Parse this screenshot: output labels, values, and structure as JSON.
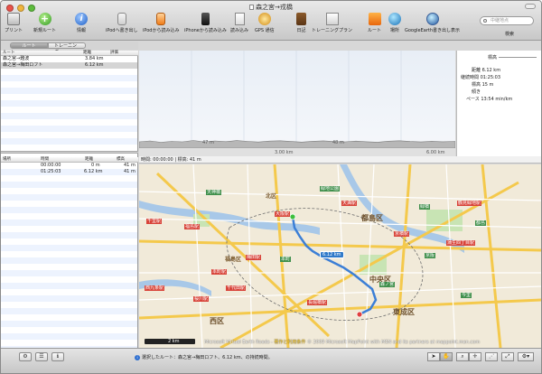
{
  "window": {
    "title": "森之宮→戎橋"
  },
  "toolbar": {
    "items": [
      {
        "label": "プリント",
        "icon": "printer-icon"
      },
      {
        "label": "新規ルート",
        "icon": "plus-icon"
      },
      {
        "label": "情報",
        "icon": "info-icon"
      },
      {
        "label": "iPodへ書き出し",
        "icon": "ipod-export-icon"
      },
      {
        "label": "iPodから読み込み",
        "icon": "ipod-import-icon"
      },
      {
        "label": "iPhoneから読み込み",
        "icon": "iphone-import-icon"
      },
      {
        "label": "読み込み",
        "icon": "import-icon"
      },
      {
        "label": "GPS 通信",
        "icon": "gps-icon"
      },
      {
        "label": "日記",
        "icon": "diary-icon"
      },
      {
        "label": "トレーニングプラン",
        "icon": "training-plan-icon"
      },
      {
        "label": "ルート",
        "icon": "route-icon"
      },
      {
        "label": "場所",
        "icon": "place-icon"
      },
      {
        "label": "GoogleEarth書き出し表示",
        "icon": "google-earth-icon"
      }
    ],
    "search": {
      "placeholder": "中継地点",
      "label": "検索"
    }
  },
  "tabs": {
    "route": "ルート",
    "training": "トレーニング"
  },
  "route_table": {
    "headers": {
      "route": "ルート",
      "distance": "距離",
      "rating": "評価"
    },
    "rows": [
      {
        "name": "森之宮→難波",
        "distance": "3.84 km",
        "selected": false
      },
      {
        "name": "森之宮→梅田ロフト",
        "distance": "6.12 km",
        "selected": true
      }
    ]
  },
  "point_table": {
    "headers": {
      "place": "場所",
      "time": "時間",
      "distance": "距離",
      "elevation": "標高"
    },
    "rows": [
      {
        "time": "00:00:00",
        "distance": "0 m",
        "elevation": "41 m"
      },
      {
        "time": "01:25:03",
        "distance": "6.12 km",
        "elevation": "41 m"
      }
    ]
  },
  "elevation_chart": {
    "x_ticks": [
      "47 m",
      "3.00 km",
      "48 m",
      "6.00 km"
    ],
    "status": "時間: 00:00:00 | 標高: 41 m"
  },
  "stats": {
    "heading": "標高",
    "distance": "距離 6.12 km",
    "duration": "継続時間 01:25:03",
    "elevation": "標高 15 m",
    "slope": "傾き",
    "pace": "ペース 13:54 min/km"
  },
  "map": {
    "districts": [
      "北区",
      "都島区",
      "中央区",
      "東成区",
      "西区",
      "福島区"
    ],
    "stations": [
      "大阪駅",
      "京橋駅",
      "福島駅",
      "本町駅",
      "天満駅",
      "千代田駅",
      "桜川駅",
      "長堀橋駅",
      "鶴見緑地駅",
      "蒲生四丁目駅",
      "西九条駅",
      "千里駅",
      "梅田駅"
    ],
    "signs": [
      "緑橋",
      "本町",
      "森ノ宮",
      "天神橋",
      "都島",
      "京阪",
      "今里",
      "緑地公園"
    ],
    "distance_badge": "6.12 km",
    "scale": "2 km",
    "credit_prefix": "Microsoft Virtual Earth Roads - ",
    "credit_link": "著作と利用条件",
    "credit_suffix": " © 2009 Microsoft MapPoint with MSN and its partners at mappoint.msn.com"
  },
  "bottom_bar": {
    "status": "選択したルート：森之宮→梅田ロフト、6.12 km、の持続時間。"
  },
  "colors": {
    "route_line": "#3c7fd6",
    "accent": "#2e6fd0"
  }
}
